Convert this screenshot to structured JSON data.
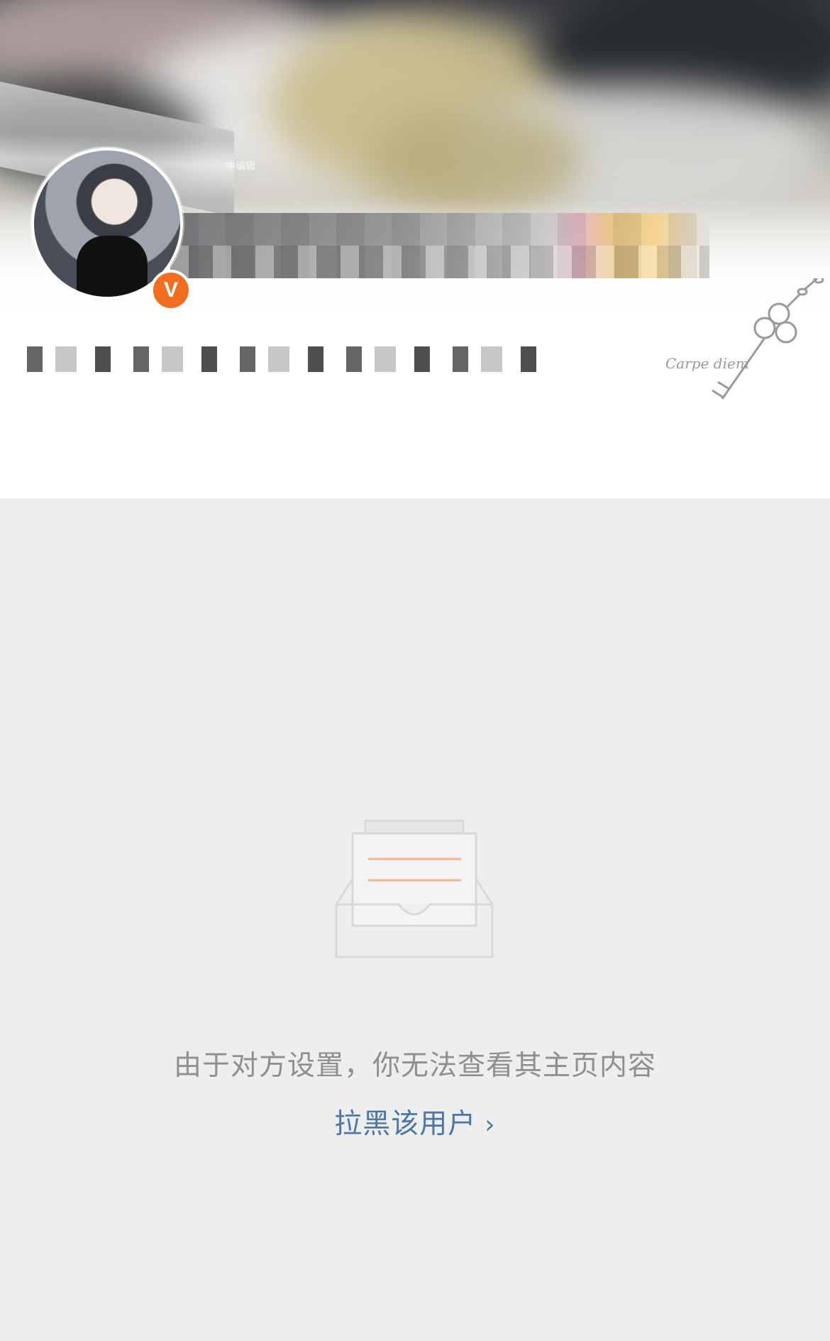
{
  "banner": {
    "small_tag": "中编辑"
  },
  "profile": {
    "verified_badge": "V",
    "decor_text": "Carpe diem",
    "name": "",
    "bio": ""
  },
  "content": {
    "empty_message": "由于对方设置，你无法查看其主页内容",
    "block_user_label": "拉黑该用户",
    "block_user_chevron": "›"
  },
  "colors": {
    "link": "#4b77a8",
    "muted_text": "#8f8f8f",
    "page_bg": "#eeeeee",
    "verified_badge": "#f36d21",
    "empty_icon_accent": "#f2b48a"
  },
  "icons": {
    "verified": "verified-badge-icon",
    "empty_state": "empty-inbox-icon",
    "decor": "key-decor-icon"
  }
}
